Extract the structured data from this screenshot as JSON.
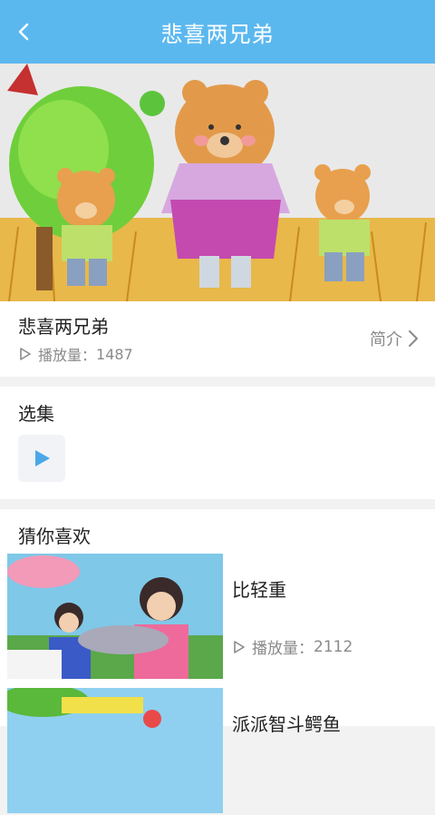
{
  "header": {
    "title": "悲喜两兄弟"
  },
  "video": {
    "title": "悲喜两兄弟",
    "plays_label": "播放量：",
    "plays": "1487",
    "intro_label": "简介"
  },
  "episodes": {
    "title": "选集"
  },
  "recommend": {
    "title": "猜你喜欢",
    "items": [
      {
        "name": "比轻重",
        "plays_label": "播放量：",
        "plays": "2112"
      },
      {
        "name": "派派智斗鳄鱼"
      }
    ]
  },
  "colors": {
    "header": "#5bb8ef",
    "accent": "#4aa8e8"
  }
}
